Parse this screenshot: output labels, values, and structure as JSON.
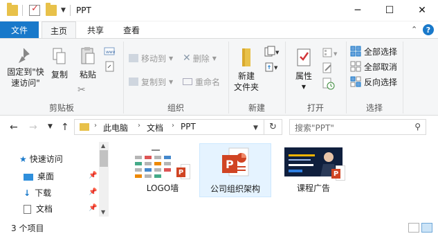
{
  "window": {
    "title": "PPT",
    "controls": {
      "minimize": "─",
      "maximize": "☐",
      "close": "✕"
    }
  },
  "ribbon_tabs": {
    "file": "文件",
    "home": "主页",
    "share": "共享",
    "view": "查看",
    "collapse": "⌃",
    "help": "?"
  },
  "ribbon": {
    "clipboard": {
      "group": "剪贴板",
      "pin_quick_access_1": "固定到\"快",
      "pin_quick_access_2": "速访问\"",
      "copy": "复制",
      "paste": "粘贴"
    },
    "organize": {
      "group": "组织",
      "move_to": "移动到",
      "copy_to": "复制到",
      "delete": "删除",
      "rename": "重命名"
    },
    "new": {
      "group": "新建",
      "new_folder_1": "新建",
      "new_folder_2": "文件夹"
    },
    "open": {
      "group": "打开",
      "properties": "属性"
    },
    "select": {
      "group": "选择",
      "select_all": "全部选择",
      "select_none": "全部取消",
      "invert": "反向选择"
    }
  },
  "address": {
    "crumbs": [
      "此电脑",
      "文档",
      "PPT"
    ],
    "search_placeholder": "搜索\"PPT\""
  },
  "nav_pane": {
    "items": [
      {
        "label": "快速访问",
        "icon": "star-icon"
      },
      {
        "label": "桌面",
        "icon": "desktop-icon"
      },
      {
        "label": "下载",
        "icon": "download-icon"
      },
      {
        "label": "文档",
        "icon": "document-icon"
      }
    ]
  },
  "files": [
    {
      "name": "LOGO墙",
      "thumb": "logo-wall"
    },
    {
      "name": "公司组织架构",
      "thumb": "ppt-blank",
      "selected": true
    },
    {
      "name": "课程广告",
      "thumb": "course-ad"
    }
  ],
  "status": {
    "count": "3 个项目"
  },
  "colors": {
    "accent": "#1979ca",
    "ppt_red": "#d04423",
    "folder": "#e8c14a"
  }
}
